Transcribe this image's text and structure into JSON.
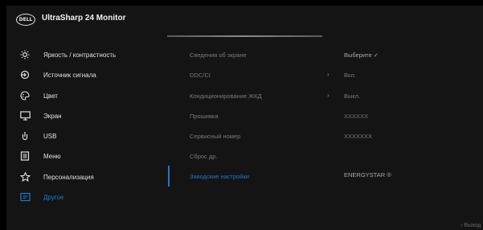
{
  "header": {
    "logo_text": "DELL",
    "title": "UltraSharp 24 Monitor"
  },
  "menu": {
    "items": [
      {
        "label": "Яркость / контрастность",
        "icon": "brightness-icon"
      },
      {
        "label": "Источник сигнала",
        "icon": "input-source-icon"
      },
      {
        "label": "Цвет",
        "icon": "color-palette-icon"
      },
      {
        "label": "Экран",
        "icon": "display-icon"
      },
      {
        "label": "USB",
        "icon": "usb-icon"
      },
      {
        "label": "Меню",
        "icon": "menu-icon"
      },
      {
        "label": "Персонализация",
        "icon": "star-icon"
      },
      {
        "label": "Другое",
        "icon": "other-icon",
        "active": true
      }
    ]
  },
  "submenu": {
    "rows": [
      {
        "label": "Сведения об экране",
        "value": "Выберите ✓",
        "arrow": ""
      },
      {
        "label": "DDC/CI",
        "value": "Вкл.",
        "arrow": "›"
      },
      {
        "label": "Кондиционирование ЖКД",
        "value": "Выкл.",
        "arrow": "›"
      },
      {
        "label": "Прошивка",
        "value": "XXXXXX",
        "arrow": ""
      },
      {
        "label": "Сервисный номер",
        "value": "XXXXXXX",
        "arrow": ""
      },
      {
        "label": "Сброс др.",
        "value": "",
        "arrow": ""
      },
      {
        "label": "Заводские настройки",
        "value": "ENERGYSTAR ®",
        "arrow": ""
      }
    ]
  },
  "footer": {
    "exit_label": "‹ Выход"
  },
  "colors": {
    "accent": "#1d7ad1",
    "background": "#141414"
  }
}
